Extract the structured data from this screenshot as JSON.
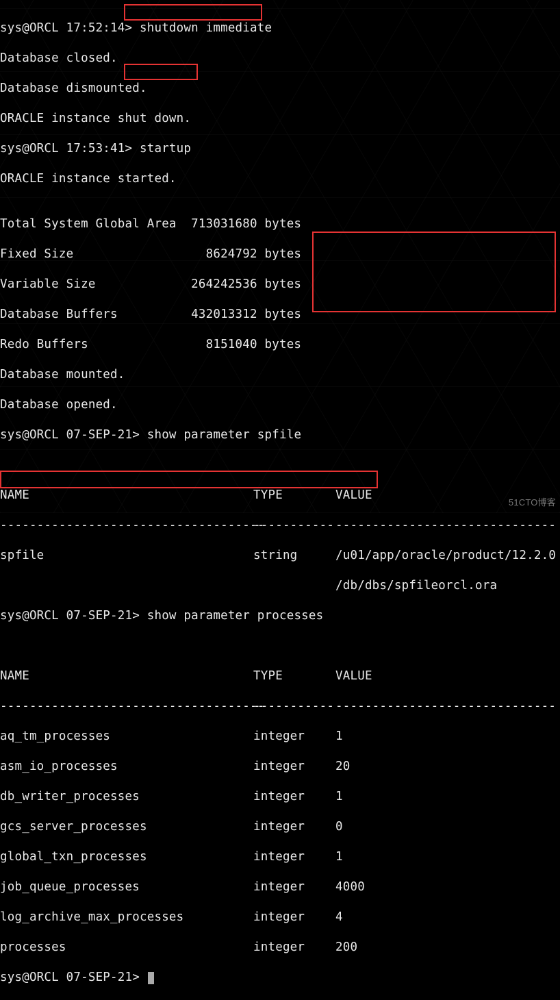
{
  "prompts": {
    "p1": "sys@ORCL 17:52:14>",
    "p2": "sys@ORCL 17:53:41>",
    "p3": "sys@ORCL 07-SEP-21>",
    "p4": "sys@ORCL 07-SEP-21>",
    "p5": "sys@ORCL 07-SEP-21>"
  },
  "commands": {
    "shutdown": " shutdown immediate",
    "startup": " startup",
    "show_spfile": " show parameter spfile",
    "show_processes": " show parameter processes"
  },
  "output": {
    "shutdown": [
      "Database closed.",
      "Database dismounted.",
      "ORACLE instance shut down."
    ],
    "startup": [
      "ORACLE instance started.",
      "",
      "Total System Global Area  713031680 bytes",
      "Fixed Size                  8624792 bytes",
      "Variable Size             264242536 bytes",
      "Database Buffers          432013312 bytes",
      "Redo Buffers                8151040 bytes",
      "Database mounted.",
      "Database opened."
    ]
  },
  "tables": {
    "header": {
      "name": "NAME",
      "type": "TYPE",
      "value": "VALUE"
    },
    "dashes": {
      "name": "------------------------------------",
      "type": "-----------",
      "value": "------------------------------"
    },
    "spfile_rows": [
      {
        "name": "spfile",
        "type": "string",
        "value": "/u01/app/oracle/product/12.2.0"
      },
      {
        "name": "",
        "type": "",
        "value": "/db/dbs/spfileorcl.ora"
      }
    ],
    "process_rows": [
      {
        "name": "aq_tm_processes",
        "type": "integer",
        "value": "1"
      },
      {
        "name": "asm_io_processes",
        "type": "integer",
        "value": "20"
      },
      {
        "name": "db_writer_processes",
        "type": "integer",
        "value": "1"
      },
      {
        "name": "gcs_server_processes",
        "type": "integer",
        "value": "0"
      },
      {
        "name": "global_txn_processes",
        "type": "integer",
        "value": "1"
      },
      {
        "name": "job_queue_processes",
        "type": "integer",
        "value": "4000"
      },
      {
        "name": "log_archive_max_processes",
        "type": "integer",
        "value": "4"
      },
      {
        "name": "processes",
        "type": "integer",
        "value": "200"
      }
    ]
  },
  "watermark": "51CTO博客"
}
